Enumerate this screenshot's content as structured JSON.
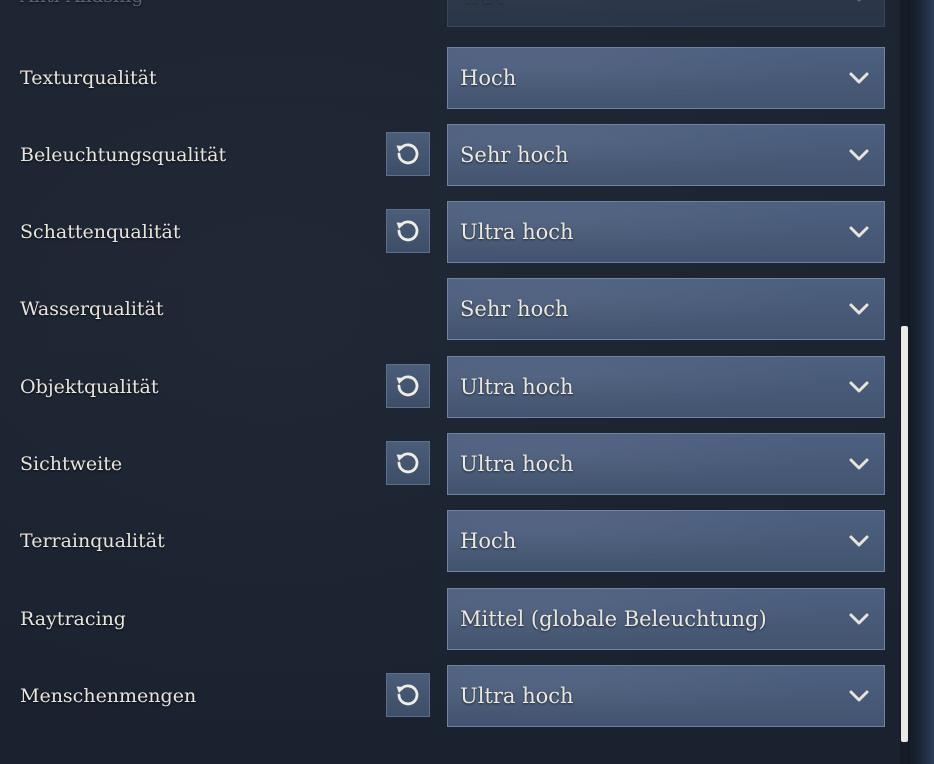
{
  "settings": [
    {
      "label": "Anti-Aliasing",
      "value": "TAA",
      "reset": false,
      "faded": true
    },
    {
      "label": "Texturqualität",
      "value": "Hoch",
      "reset": false
    },
    {
      "label": "Beleuchtungsqualität",
      "value": "Sehr hoch",
      "reset": true
    },
    {
      "label": "Schattenqualität",
      "value": "Ultra hoch",
      "reset": true
    },
    {
      "label": "Wasserqualität",
      "value": "Sehr hoch",
      "reset": false
    },
    {
      "label": "Objektqualität",
      "value": "Ultra hoch",
      "reset": true
    },
    {
      "label": "Sichtweite",
      "value": "Ultra hoch",
      "reset": true
    },
    {
      "label": "Terrainqualität",
      "value": "Hoch",
      "reset": false
    },
    {
      "label": "Raytracing",
      "value": "Mittel (globale Beleuchtung)",
      "reset": false
    },
    {
      "label": "Menschenmengen",
      "value": "Ultra hoch",
      "reset": true
    }
  ],
  "icons": {
    "reset": "reset-icon",
    "dropdown": "chevron-down-icon"
  },
  "colors": {
    "background": "#1b2330",
    "dropdown": "#485a78",
    "text": "#e8e4dc",
    "scrollbar_thumb": "#e9e9e6"
  }
}
